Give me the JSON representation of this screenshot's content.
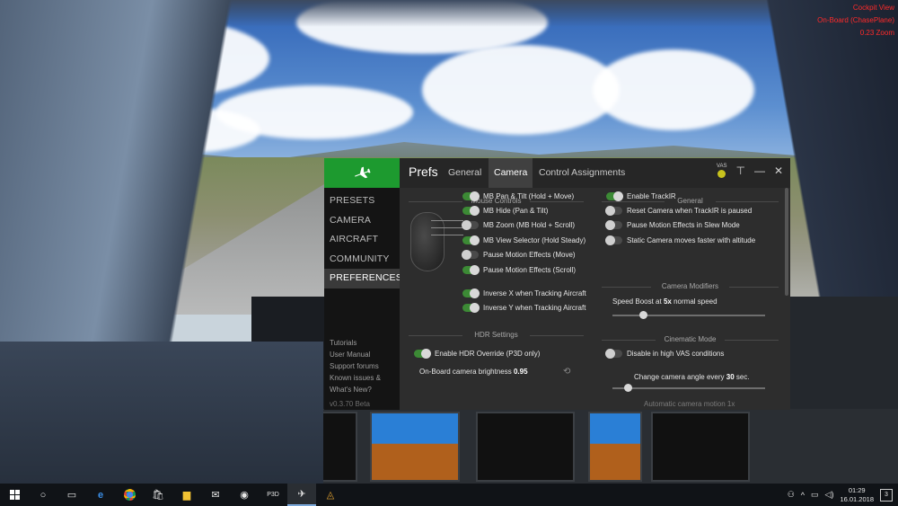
{
  "overlay": {
    "lines": [
      "Cockpit View",
      "On-Board (ChasePlane)",
      "0.23 Zoom"
    ]
  },
  "app": {
    "sidebar": {
      "items": [
        {
          "label": "PRESETS"
        },
        {
          "label": "CAMERA"
        },
        {
          "label": "AIRCRAFT"
        },
        {
          "label": "COMMUNITY"
        },
        {
          "label": "PREFERENCES"
        }
      ],
      "links": [
        "Tutorials",
        "User Manual",
        "Support forums",
        "Known issues &",
        "What's New?"
      ],
      "version": "v0.3.70 Beta"
    },
    "header": {
      "title": "Prefs",
      "tabs": [
        "General",
        "Camera",
        "Control Assignments"
      ],
      "vas_label": "VAS",
      "pin": "⊤",
      "minimize": "—",
      "close": "✕"
    },
    "mouse_controls": {
      "heading": "Mouse Controls",
      "options": [
        {
          "label": "MB Pan & Tilt (Hold + Move)",
          "on": true
        },
        {
          "label": "MB Hide (Pan & Tilt)",
          "on": true
        },
        {
          "label": "MB Zoom (MB Hold + Scroll)",
          "on": false
        },
        {
          "label": "MB View Selector (Hold Steady)",
          "on": true
        },
        {
          "label": "Pause Motion Effects (Move)",
          "on": false
        },
        {
          "label": "Pause Motion Effects (Scroll)",
          "on": true
        },
        {
          "label": "Inverse X when Tracking Aircraft",
          "on": true
        },
        {
          "label": "Inverse Y when Tracking Aircraft",
          "on": true
        }
      ]
    },
    "hdr": {
      "heading": "HDR Settings",
      "enable_label": "Enable HDR Override (P3D only)",
      "enable_on": true,
      "brightness_label": "On-Board camera brightness",
      "brightness_value": "0.95"
    },
    "general": {
      "heading": "General",
      "options": [
        {
          "label": "Enable TrackIR",
          "on": true
        },
        {
          "label": "Reset Camera when TrackIR is paused",
          "on": false
        },
        {
          "label": "Pause Motion Effects in Slew Mode",
          "on": false
        },
        {
          "label": "Static Camera moves faster with altitude",
          "on": false
        }
      ]
    },
    "camera_modifiers": {
      "heading": "Camera Modifiers",
      "speed_prefix": "Speed Boost at",
      "speed_value": "5x",
      "speed_suffix": "normal speed",
      "speed_fraction": 0.2
    },
    "cinematic": {
      "heading": "Cinematic Mode",
      "vas_label": "Disable in high VAS conditions",
      "vas_on": false,
      "angle_prefix": "Change camera angle every",
      "angle_value": "30",
      "angle_suffix": "sec.",
      "angle_fraction": 0.1,
      "auto_label": "Automatic camera motion 1x"
    }
  },
  "taskbar": {
    "time": "01:29",
    "date": "16.01.2018",
    "p3d_label": "P3D",
    "notification_count": "3"
  }
}
